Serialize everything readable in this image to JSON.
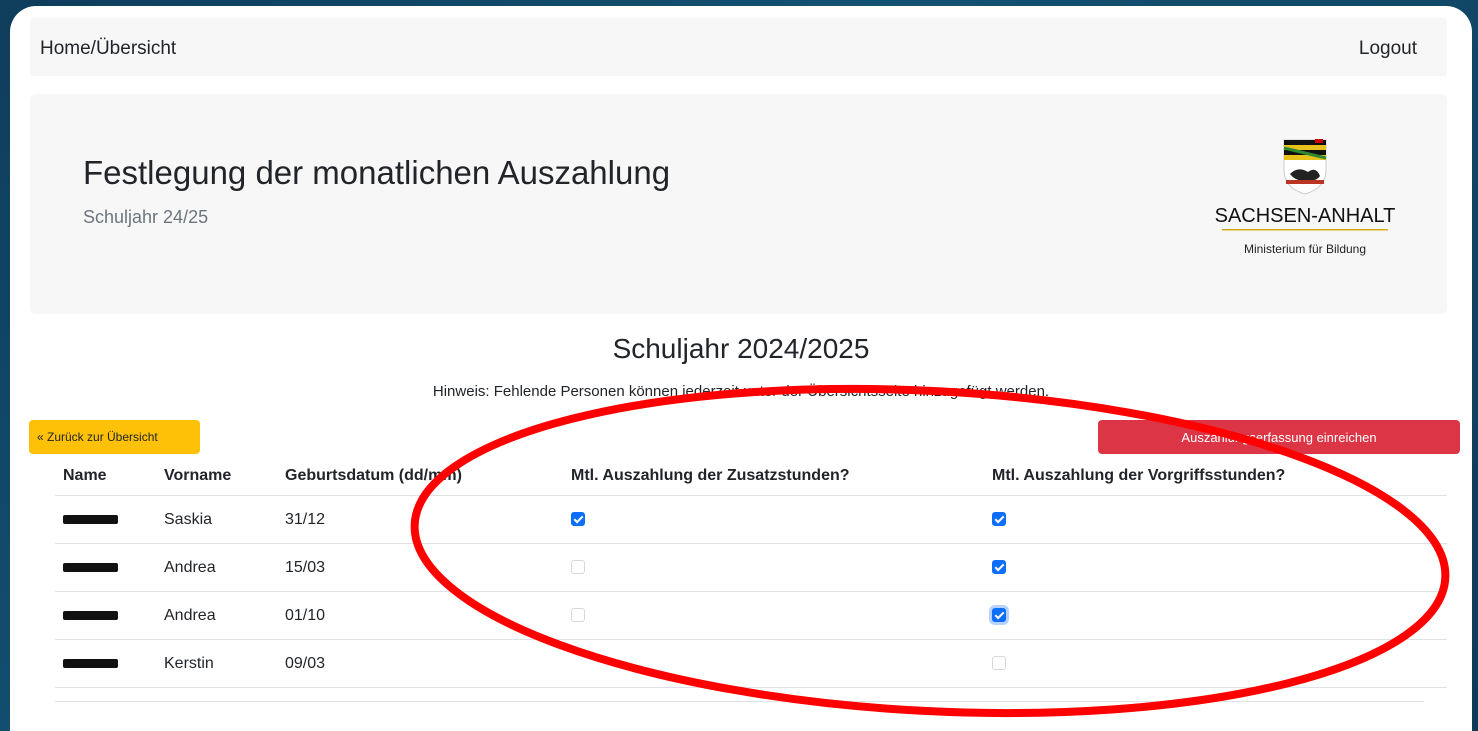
{
  "nav": {
    "home_label": "Home/Übersicht",
    "logout_label": "Logout"
  },
  "hero": {
    "title": "Festlegung der monatlichen Auszahlung",
    "subtitle": "Schuljahr 24/25",
    "logo_state": "SACHSEN-ANHALT",
    "logo_ministry": "Ministerium für Bildung"
  },
  "section": {
    "title": "Schuljahr 2024/2025",
    "hint": "Hinweis: Fehlende Personen können jederzeit unter der Übersichtsseite hinzugefügt werden."
  },
  "buttons": {
    "back_label": "« Zurück zur Übersicht",
    "submit_label": "Auszahlungserfassung einreichen"
  },
  "table": {
    "headers": [
      "Name",
      "Vorname",
      "Geburtsdatum (dd/mm)",
      "Mtl. Auszahlung der Zusatzstunden?",
      "Mtl. Auszahlung der Vorgriffsstunden?"
    ],
    "rows": [
      {
        "vorname": "Saskia",
        "geburtsdatum": "31/12",
        "zusatz": true,
        "vorgriff": true
      },
      {
        "vorname": "Andrea",
        "geburtsdatum": "15/03",
        "zusatz": false,
        "vorgriff": true
      },
      {
        "vorname": "Andrea",
        "geburtsdatum": "01/10",
        "zusatz": false,
        "vorgriff": true
      },
      {
        "vorname": "Kerstin",
        "geburtsdatum": "09/03",
        "zusatz": null,
        "vorgriff": false
      }
    ]
  },
  "colors": {
    "accent": "#0d6efd",
    "warning": "#ffc107",
    "danger": "#dc3545",
    "annotation": "#ff0000"
  }
}
